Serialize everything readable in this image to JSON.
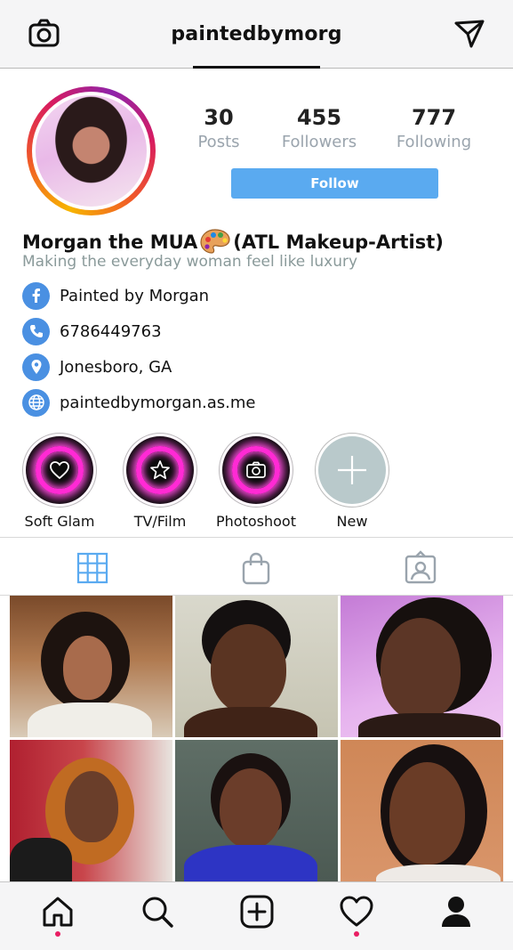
{
  "header": {
    "username": "paintedbymorg",
    "left_icon": "camera-icon",
    "right_icon": "send-icon"
  },
  "profile": {
    "stats": [
      {
        "value": "30",
        "label": "Posts"
      },
      {
        "value": "455",
        "label": "Followers"
      },
      {
        "value": "777",
        "label": "Following"
      }
    ],
    "follow_label": "Follow",
    "display_name_pre": "Morgan the MUA",
    "display_name_post": "(ATL Makeup-Artist)",
    "tagline": "Making the everyday woman feel like luxury",
    "info": [
      {
        "icon": "facebook-icon",
        "text": "Painted by Morgan"
      },
      {
        "icon": "phone-icon",
        "text": "6786449763"
      },
      {
        "icon": "location-icon",
        "text": "Jonesboro, GA"
      },
      {
        "icon": "globe-icon",
        "text": "paintedbymorgan.as.me"
      }
    ]
  },
  "highlights": [
    {
      "label": "Soft Glam",
      "icon": "heart-icon"
    },
    {
      "label": "TV/Film",
      "icon": "star-icon"
    },
    {
      "label": "Photoshoot",
      "icon": "camera-icon"
    },
    {
      "label": "New",
      "icon": "plus-icon"
    }
  ],
  "tabs": [
    {
      "icon": "grid-icon",
      "active": true
    },
    {
      "icon": "shopping-bag-icon",
      "active": false
    },
    {
      "icon": "tagged-icon",
      "active": false
    }
  ],
  "bottom_nav": [
    {
      "icon": "home-icon",
      "notification": true
    },
    {
      "icon": "search-icon",
      "notification": false
    },
    {
      "icon": "add-post-icon",
      "notification": false
    },
    {
      "icon": "heart-icon",
      "notification": true
    },
    {
      "icon": "profile-icon",
      "notification": false
    }
  ],
  "colors": {
    "accent_blue": "#5aaaf0",
    "info_icon_blue": "#4a90e2",
    "highlight_glow": "#ff2ad4",
    "notification_dot": "#e91e63"
  }
}
